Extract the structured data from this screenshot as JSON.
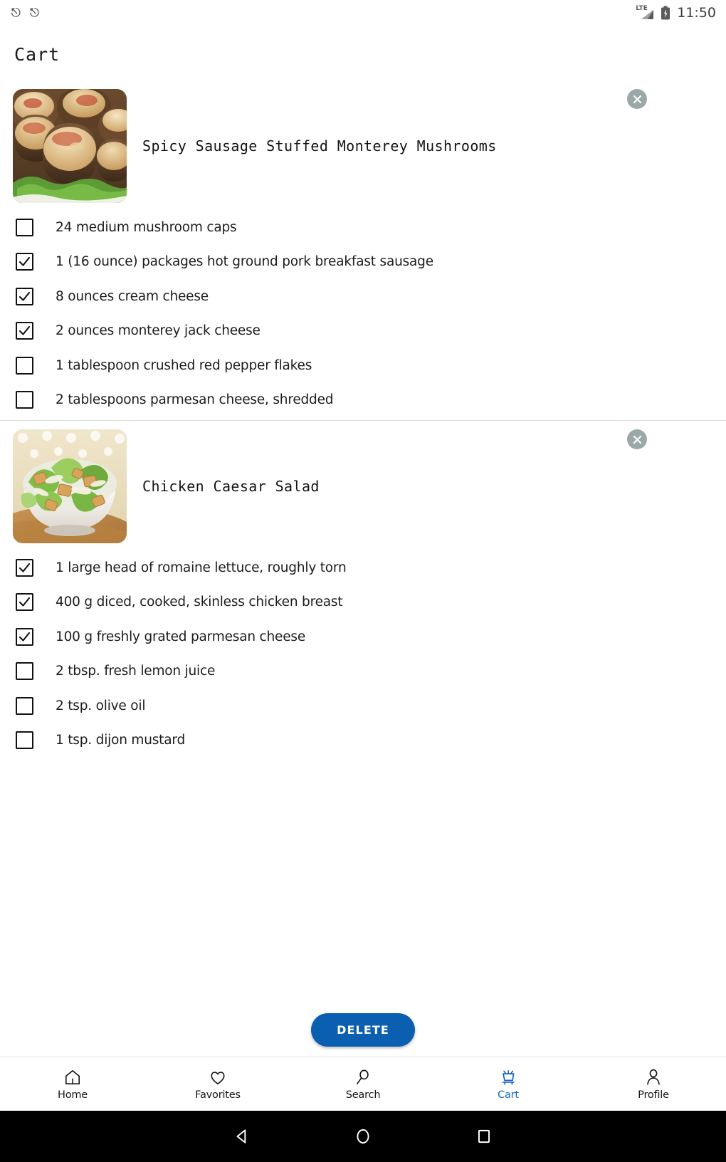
{
  "status_bar": {
    "nfc_icon_1": "nfc-icon",
    "nfc_icon_2": "nfc-icon",
    "network_label": "LTE",
    "signal_icon": "signal-bars-icon",
    "battery_icon": "battery-charging-icon",
    "time": "11:50"
  },
  "header": {
    "title": "Cart"
  },
  "colors": {
    "accent": "#1565C0",
    "delete_button": "#0B5FB0",
    "close_button": "#9AA8A8",
    "text": "#1C1C1C"
  },
  "cart": {
    "items": [
      {
        "title": "Spicy Sausage Stuffed Monterey Mushrooms",
        "image_alt": "stuffed-mushrooms-photo",
        "remove_icon": "close-circle-icon",
        "ingredients": [
          {
            "label": "24 medium mushroom caps",
            "checked": false
          },
          {
            "label": "1 (16 ounce) packages hot ground pork breakfast sausage",
            "checked": true
          },
          {
            "label": "8 ounces cream cheese",
            "checked": true
          },
          {
            "label": "2 ounces monterey jack cheese",
            "checked": true
          },
          {
            "label": "1 tablespoon crushed red pepper flakes",
            "checked": false
          },
          {
            "label": "2 tablespoons parmesan cheese, shredded",
            "checked": false
          }
        ]
      },
      {
        "title": "Chicken Caesar Salad",
        "image_alt": "chicken-caesar-salad-photo",
        "remove_icon": "close-circle-icon",
        "ingredients": [
          {
            "label": "1 large head of romaine lettuce, roughly torn",
            "checked": true
          },
          {
            "label": "400 g diced, cooked, skinless chicken breast",
            "checked": true
          },
          {
            "label": "100 g freshly grated parmesan cheese",
            "checked": true
          },
          {
            "label": "2 tbsp. fresh lemon juice",
            "checked": false
          },
          {
            "label": "2 tsp. olive oil",
            "checked": false
          },
          {
            "label": "1 tsp. dijon mustard",
            "checked": false
          }
        ]
      }
    ]
  },
  "actions": {
    "delete_label": "DELETE"
  },
  "bottom_nav": {
    "items": [
      {
        "label": "Home",
        "icon": "home-icon",
        "active": false
      },
      {
        "label": "Favorites",
        "icon": "heart-icon",
        "active": false
      },
      {
        "label": "Search",
        "icon": "search-icon",
        "active": false
      },
      {
        "label": "Cart",
        "icon": "shopping-cart-icon",
        "active": true
      },
      {
        "label": "Profile",
        "icon": "person-icon",
        "active": false
      }
    ]
  },
  "system_nav": {
    "back": "back-triangle-icon",
    "home": "home-circle-icon",
    "recents": "recents-square-icon"
  }
}
